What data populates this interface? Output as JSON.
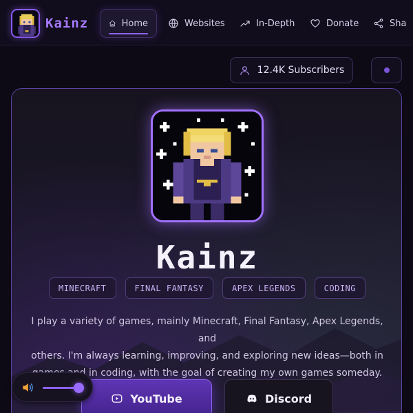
{
  "navbar": {
    "brand_name": "Kainz",
    "items": [
      {
        "label": "Home",
        "icon": "home-icon",
        "active": true
      },
      {
        "label": "Websites",
        "icon": "globe-icon"
      },
      {
        "label": "In-Depth",
        "icon": "trend-icon"
      },
      {
        "label": "Donate",
        "icon": "heart-icon"
      },
      {
        "label": "Sha",
        "icon": "share-icon"
      }
    ]
  },
  "stats": {
    "subscribers": "12.4K Subscribers"
  },
  "profile": {
    "name": "Kainz",
    "tags": [
      "MINECRAFT",
      "FINAL FANTASY",
      "APEX LEGENDS",
      "CODING"
    ],
    "bio_lines": [
      "I play a variety of games, mainly Minecraft, Final Fantasy, Apex Legends, and",
      "others. I'm always learning, improving, and exploring new ideas—both in",
      "games and in coding, with the goal of creating my own games someday."
    ],
    "buttons": {
      "youtube": "YouTube",
      "discord": "Discord"
    }
  },
  "audio": {
    "volume": 0.9
  },
  "colors": {
    "accent": "#8e63ff",
    "background": "#0d0a16",
    "card_border": "#5b44a0"
  }
}
